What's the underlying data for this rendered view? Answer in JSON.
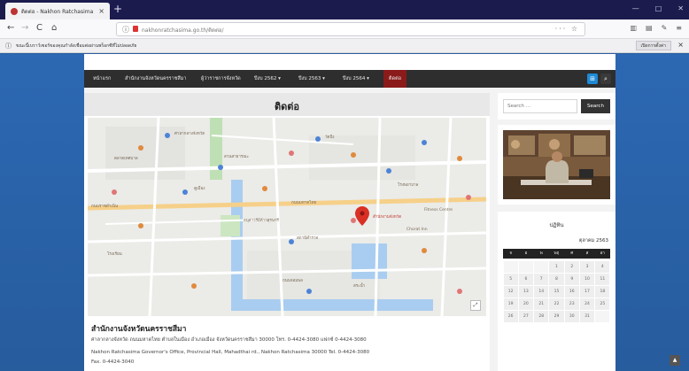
{
  "browser": {
    "tab_title": "ติดต่อ - Nakhon Ratchasima",
    "tab_close": "×",
    "new_tab": "+",
    "url": "nakhonratchasima.go.th/ติดต่อ/",
    "url_actions": "··· ☆",
    "infobar_text": "ขณะนี้เบราว์เซอร์ของคุณกำลังเชื่อมต่อผ่านพร็อกซีที่ไม่ปลอดภัย",
    "infobar_button": "เปิดการตั้งค่า",
    "infobar_close": "×"
  },
  "menu": {
    "items": [
      {
        "label": "หน้าแรก"
      },
      {
        "label": "สำนักงานจังหวัดนครราชสีมา"
      },
      {
        "label": "ผู้ว่าราชการจังหวัด"
      },
      {
        "label": "ปีงบ 2562 ▾"
      },
      {
        "label": "ปีงบ 2563 ▾"
      },
      {
        "label": "ปีงบ 2564 ▾"
      },
      {
        "label": "ติดต่อ"
      }
    ]
  },
  "page": {
    "title": "ติดต่อ"
  },
  "map": {
    "labels": [
      "ศาลากลางจังหวัด",
      "สวนสาธารณะ",
      "ตลาดเทศบาล",
      "วัดบึง",
      "คูเมือง",
      "โรงพยาบาล",
      "ถนนราชดำเนิน",
      "ถนนมหาดไทย",
      "อนุสาวรีย์ท้าวสุรนารี",
      "สำนักงานจังหวัด",
      "สถานีตำรวจ",
      "โรงเรียน",
      "ถนนจอมพล",
      "สระน้ำ",
      "Chorat Inn",
      "Fitness Centre"
    ],
    "fullscreen_icon": "⤢"
  },
  "contact": {
    "org_name": "สำนักงานจังหวัดนครราชสีมา",
    "address_th": "ศาลากลางจังหวัด ถนนมหาดไทย ตำบลในเมือง อำเภอเมือง จังหวัดนครราชสีมา 30000 โทร. 0-4424-3080 แฟกซ์ 0-4424-3080",
    "address_en": "Nakhon Ratchasima Governor's Office, Provincial Hall, Mahadthai rd., Nakhon Ratchasima 30000 Tel. 0-4424-3080",
    "fax_en": "Fax. 0-4424-3040"
  },
  "sidebar": {
    "search_placeholder": "Search …",
    "search_button": "Search",
    "calendar_title": "ปฏิทิน",
    "calendar_month": "ตุลาคม 2563",
    "weekdays": [
      "จ",
      "อ",
      "พ",
      "พฤ",
      "ศ",
      "ส",
      "อา"
    ],
    "weeks": [
      [
        "",
        "",
        "",
        "1",
        "2",
        "3",
        "4"
      ],
      [
        "5",
        "6",
        "7",
        "8",
        "9",
        "10",
        "11"
      ],
      [
        "12",
        "13",
        "14",
        "15",
        "16",
        "17",
        "18"
      ],
      [
        "19",
        "20",
        "21",
        "22",
        "23",
        "24",
        "25"
      ],
      [
        "26",
        "27",
        "28",
        "29",
        "30",
        "31",
        ""
      ]
    ]
  },
  "icons": {
    "back": "←",
    "forward": "→",
    "reload": "C",
    "home": "⌂",
    "info": "ⓘ",
    "grid": "⊞",
    "search": "⌕",
    "scroll_top": "▲"
  },
  "colors": {
    "menu_bg": "#2e2e2e",
    "menu_active": "#8b1a1a",
    "page_bg": "#2c68b3",
    "accent_blue": "#1e8ad6"
  }
}
